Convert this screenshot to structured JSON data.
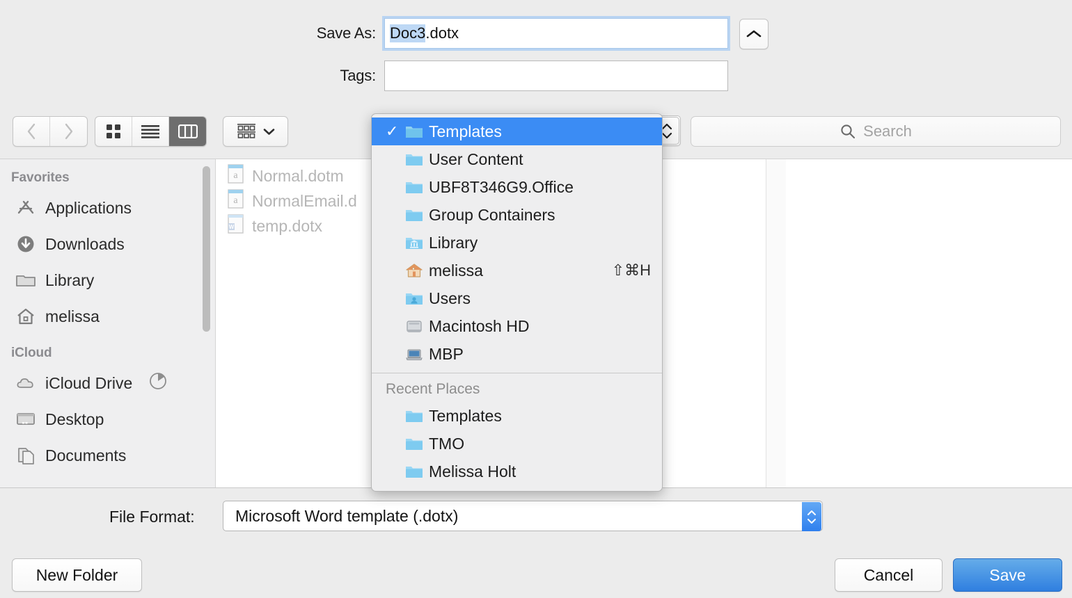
{
  "save_as": {
    "label": "Save As:",
    "value_selected": "Doc3",
    "value_rest": ".dotx",
    "collapse_icon": "chevron-up-icon"
  },
  "tags": {
    "label": "Tags:",
    "value": "",
    "placeholder": ""
  },
  "toolbar": {
    "back_icon": "chevron-left-icon",
    "forward_icon": "chevron-right-icon",
    "icon_view_icon": "grid-view-icon",
    "list_view_icon": "list-view-icon",
    "column_view_icon": "column-view-icon",
    "arrange_icon": "arrange-icon",
    "arrange_chevron_icon": "chevron-down-icon"
  },
  "search": {
    "placeholder": "Search",
    "icon": "search-icon"
  },
  "sidebar": {
    "sections": [
      {
        "title": "Favorites",
        "items": [
          {
            "label": "Applications",
            "icon": "applications-icon"
          },
          {
            "label": "Downloads",
            "icon": "downloads-icon"
          },
          {
            "label": "Library",
            "icon": "folder-icon"
          },
          {
            "label": "melissa",
            "icon": "home-icon"
          }
        ]
      },
      {
        "title": "iCloud",
        "items": [
          {
            "label": "iCloud Drive",
            "icon": "cloud-icon",
            "badge_icon": "sync-progress-icon"
          },
          {
            "label": "Desktop",
            "icon": "desktop-icon"
          },
          {
            "label": "Documents",
            "icon": "documents-icon"
          }
        ]
      }
    ]
  },
  "file_list": [
    {
      "name": "Normal.dotm",
      "icon": "word-macro-template-icon"
    },
    {
      "name": "NormalEmail.d",
      "icon": "word-macro-template-icon"
    },
    {
      "name": "temp.dotx",
      "icon": "word-template-icon"
    }
  ],
  "where_menu": {
    "items": [
      {
        "label": "Templates",
        "icon": "folder-blue-icon",
        "checked": true,
        "selected": true,
        "shortcut": ""
      },
      {
        "label": "User Content",
        "icon": "folder-blue-icon",
        "checked": false,
        "selected": false,
        "shortcut": ""
      },
      {
        "label": "UBF8T346G9.Office",
        "icon": "folder-blue-icon",
        "checked": false,
        "selected": false,
        "shortcut": ""
      },
      {
        "label": "Group Containers",
        "icon": "folder-blue-icon",
        "checked": false,
        "selected": false,
        "shortcut": ""
      },
      {
        "label": "Library",
        "icon": "folder-library-icon",
        "checked": false,
        "selected": false,
        "shortcut": ""
      },
      {
        "label": "melissa",
        "icon": "home-color-icon",
        "checked": false,
        "selected": false,
        "shortcut": "⇧⌘H"
      },
      {
        "label": "Users",
        "icon": "folder-users-icon",
        "checked": false,
        "selected": false,
        "shortcut": ""
      },
      {
        "label": "Macintosh HD",
        "icon": "hard-drive-icon",
        "checked": false,
        "selected": false,
        "shortcut": ""
      },
      {
        "label": "MBP",
        "icon": "laptop-icon",
        "checked": false,
        "selected": false,
        "shortcut": ""
      }
    ],
    "recent_section_title": "Recent Places",
    "recent_items": [
      {
        "label": "Templates",
        "icon": "folder-blue-icon"
      },
      {
        "label": "TMO",
        "icon": "folder-blue-icon"
      },
      {
        "label": "Melissa Holt",
        "icon": "folder-blue-icon"
      }
    ],
    "stepper_icon": "stepper-updown-icon"
  },
  "file_format": {
    "label": "File Format:",
    "value": "Microsoft Word template (.dotx)",
    "stepper_icon": "stepper-updown-icon"
  },
  "buttons": {
    "new_folder": "New Folder",
    "cancel": "Cancel",
    "save": "Save"
  },
  "colors": {
    "accent": "#3b8cf4",
    "selection": "#bed8f5",
    "default_button": "#2f7fe0"
  }
}
